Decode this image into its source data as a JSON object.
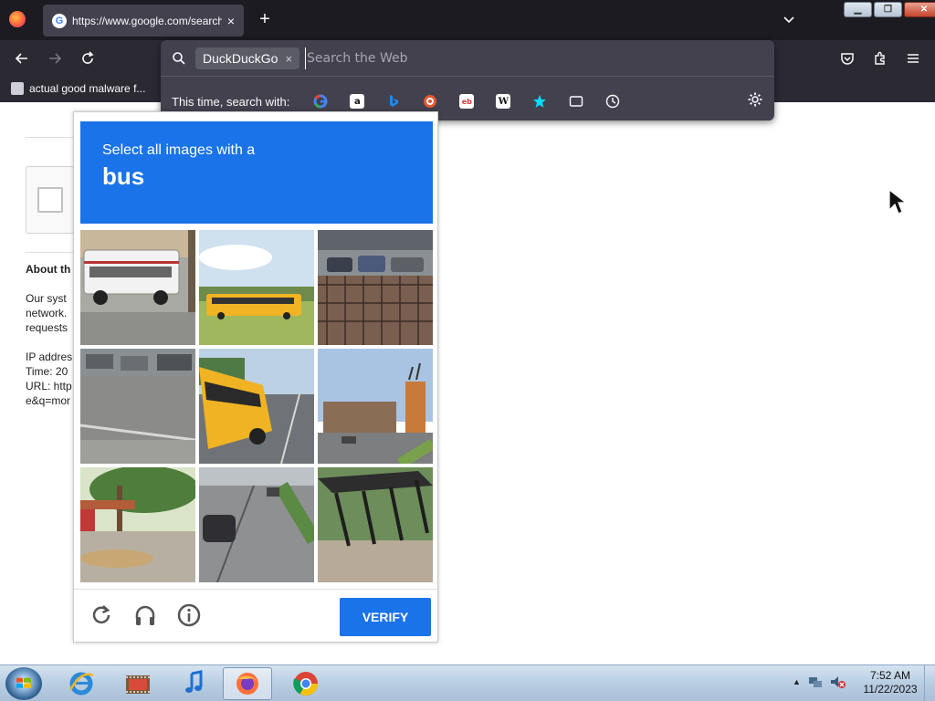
{
  "browser": {
    "tab": {
      "title": "https://www.google.com/search?q=",
      "close": "×"
    },
    "new_tab": "+",
    "bookmark": {
      "label": "actual good malware f..."
    }
  },
  "urlbar": {
    "engine_chip": "DuckDuckGo",
    "chip_close": "×",
    "placeholder": "Search the Web",
    "search_with_label": "This time, search with:",
    "engines": [
      "google",
      "amazon",
      "bing",
      "duckduckgo",
      "ebay",
      "wikipedia",
      "bookmarks",
      "tabs",
      "history"
    ]
  },
  "page": {
    "about": "About th",
    "lines": [
      "Our syst",
      "network.",
      "requests",
      "",
      "IP addres",
      "Time: 20",
      "URL: http",
      "e&q=mor"
    ]
  },
  "captcha": {
    "instruction": "Select all images with a",
    "target": "bus",
    "verify": "VERIFY"
  },
  "taskbar": {
    "time": "7:52 AM",
    "date": "11/22/2023"
  },
  "colors": {
    "accent": "#1a73e8",
    "browser_bg": "#1c1b22",
    "toolbar": "#2b2a33"
  }
}
